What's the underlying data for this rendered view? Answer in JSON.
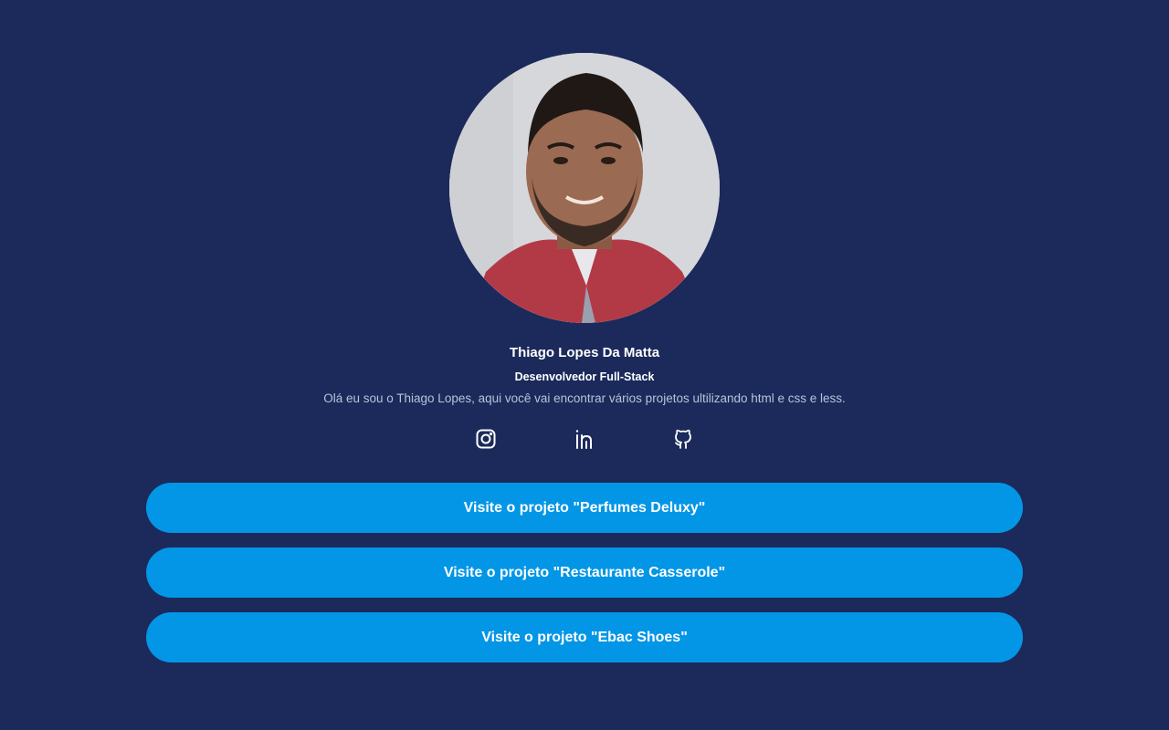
{
  "profile": {
    "name": "Thiago Lopes Da Matta",
    "role": "Desenvolvedor Full-Stack",
    "bio": "Olá eu sou o Thiago Lopes, aqui você vai encontrar vários projetos ultilizando html e css e less."
  },
  "social": [
    {
      "icon": "instagram-icon"
    },
    {
      "icon": "linkedin-icon"
    },
    {
      "icon": "github-icon"
    }
  ],
  "projects": [
    {
      "label": "Visite o projeto \"Perfumes Deluxy\""
    },
    {
      "label": "Visite o projeto \"Restaurante Casserole\""
    },
    {
      "label": "Visite o projeto \"Ebac Shoes\""
    }
  ],
  "colors": {
    "background": "#1b2a5b",
    "button": "#0396e6",
    "text": "#ffffff",
    "muted_text": "#b9c2d8"
  }
}
